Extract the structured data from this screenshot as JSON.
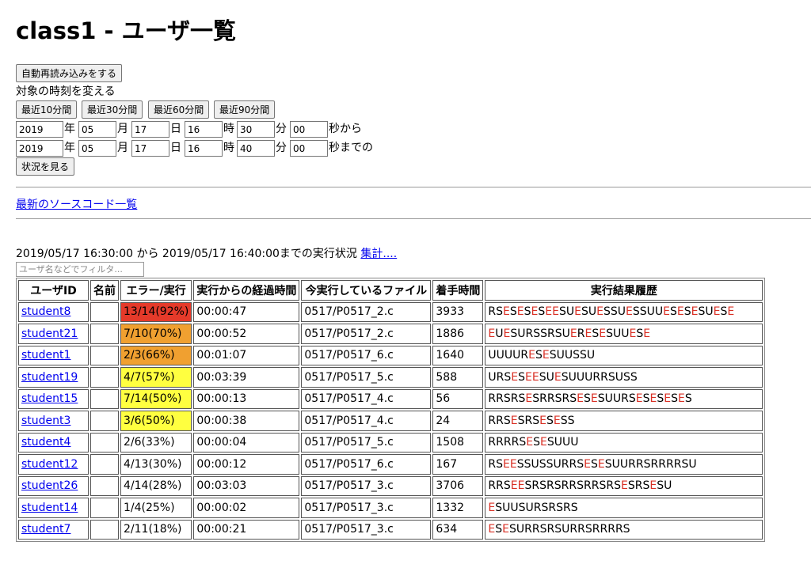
{
  "page": {
    "title": "class1 - ユーザ一覧"
  },
  "controls": {
    "auto_reload_label": "自動再読み込みをする",
    "change_time_label": "対象の時刻を変える",
    "presets": [
      "最近10分間",
      "最近30分間",
      "最近60分間",
      "最近90分間"
    ],
    "from": {
      "year": "2019",
      "month": "05",
      "day": "17",
      "hour": "16",
      "minute": "30",
      "second": "00"
    },
    "to": {
      "year": "2019",
      "month": "05",
      "day": "17",
      "hour": "16",
      "minute": "40",
      "second": "00"
    },
    "units": {
      "year": "年",
      "month": "月",
      "day": "日",
      "hour": "時",
      "minute": "分"
    },
    "from_suffix": "秒から",
    "to_suffix": "秒までの",
    "view_status_label": "状況を見る"
  },
  "links": {
    "latest_source": "最新のソースコード一覧"
  },
  "status": {
    "range_text": "2019/05/17 16:30:00 から 2019/05/17 16:40:00までの実行状況",
    "summary_link": "集計...."
  },
  "filter": {
    "placeholder": "ユーザ名などでフィルタ..."
  },
  "colors": {
    "red": "#e53a2a",
    "orange": "#f0a030",
    "yellow": "#ffff40",
    "error_letter": "#d93025",
    "link": "#0000ee"
  },
  "table": {
    "headers": [
      "ユーザID",
      "名前",
      "エラー/実行",
      "実行からの経過時間",
      "今実行しているファイル",
      "着手時間",
      "実行結果履歴"
    ],
    "rows": [
      {
        "id": "student8",
        "name": "",
        "error": "13/14(92%)",
        "level": "red",
        "elapsed": "00:00:47",
        "file": "0517/P0517_2.c",
        "start": "3933",
        "history": "RSESESESEESUESUESSUESSUUESESESUESE"
      },
      {
        "id": "student21",
        "name": "",
        "error": "7/10(70%)",
        "level": "orange",
        "elapsed": "00:00:52",
        "file": "0517/P0517_2.c",
        "start": "1886",
        "history": "EUESURSSRSUERESESUUESE"
      },
      {
        "id": "student1",
        "name": "",
        "error": "2/3(66%)",
        "level": "orange",
        "elapsed": "00:01:07",
        "file": "0517/P0517_6.c",
        "start": "1640",
        "history": "UUUURESESUUSSU"
      },
      {
        "id": "student19",
        "name": "",
        "error": "4/7(57%)",
        "level": "yellow",
        "elapsed": "00:03:39",
        "file": "0517/P0517_5.c",
        "start": "588",
        "history": "URSESEESUESUUURRSUSS"
      },
      {
        "id": "student15",
        "name": "",
        "error": "7/14(50%)",
        "level": "yellow",
        "elapsed": "00:00:13",
        "file": "0517/P0517_4.c",
        "start": "56",
        "history": "RRSRSESRRSRSESESUURSESESESES"
      },
      {
        "id": "student3",
        "name": "",
        "error": "3/6(50%)",
        "level": "yellow",
        "elapsed": "00:00:38",
        "file": "0517/P0517_4.c",
        "start": "24",
        "history": "RRSESRSESESS"
      },
      {
        "id": "student4",
        "name": "",
        "error": "2/6(33%)",
        "level": "none",
        "elapsed": "00:00:04",
        "file": "0517/P0517_5.c",
        "start": "1508",
        "history": "RRRRSESESUUU"
      },
      {
        "id": "student12",
        "name": "",
        "error": "4/13(30%)",
        "level": "none",
        "elapsed": "00:00:12",
        "file": "0517/P0517_6.c",
        "start": "167",
        "history": "RSEESSUSSURRSESESUURRSRRRRSU"
      },
      {
        "id": "student26",
        "name": "",
        "error": "4/14(28%)",
        "level": "none",
        "elapsed": "00:03:03",
        "file": "0517/P0517_3.c",
        "start": "3706",
        "history": "RRSEESRSRSRRSRRSRSESRSESU"
      },
      {
        "id": "student14",
        "name": "",
        "error": "1/4(25%)",
        "level": "none",
        "elapsed": "00:00:02",
        "file": "0517/P0517_3.c",
        "start": "1332",
        "history": "ESUUSURSRSRS"
      },
      {
        "id": "student7",
        "name": "",
        "error": "2/11(18%)",
        "level": "none",
        "elapsed": "00:00:21",
        "file": "0517/P0517_3.c",
        "start": "634",
        "history": "ESESURRSRSURRSRRRRS"
      }
    ]
  }
}
